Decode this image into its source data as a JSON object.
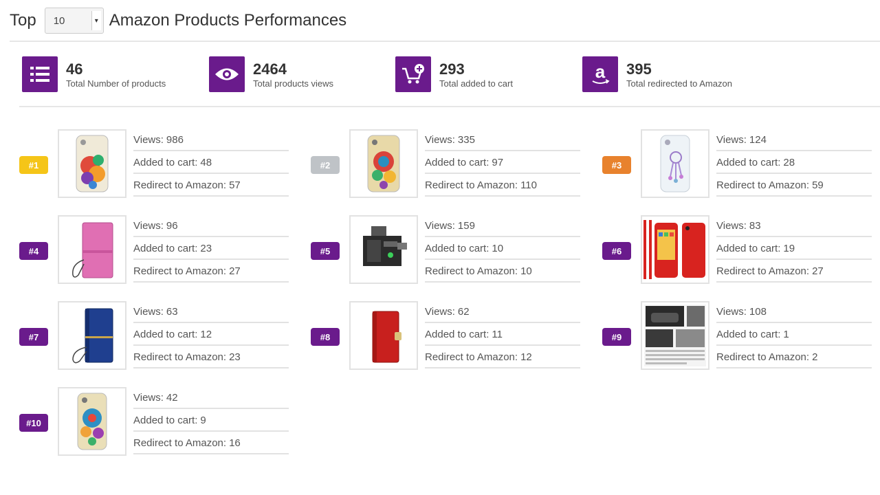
{
  "header": {
    "top_label": "Top",
    "select_value": "10",
    "title": "Amazon Products Performances"
  },
  "stats": [
    {
      "icon": "list-icon",
      "value": "46",
      "label": "Total Number of products"
    },
    {
      "icon": "eye-icon",
      "value": "2464",
      "label": "Total products views"
    },
    {
      "icon": "cart-add-icon",
      "value": "293",
      "label": "Total added to cart"
    },
    {
      "icon": "amazon-icon",
      "value": "395",
      "label": "Total redirected to Amazon"
    }
  ],
  "labels": {
    "views": "Views:",
    "cart": "Added to cart:",
    "redirect": "Redirect to Amazon:"
  },
  "colors": {
    "purple": "#6a1b8c",
    "gold": "#f5c518",
    "silver": "#bfc3c7",
    "bronze": "#e8822d"
  },
  "products": [
    {
      "rank": "#1",
      "views": "986",
      "cart": "48",
      "redirect": "57",
      "thumb": "floral-phone-case"
    },
    {
      "rank": "#2",
      "views": "335",
      "cart": "97",
      "redirect": "110",
      "thumb": "colorful-owl-phone-case"
    },
    {
      "rank": "#3",
      "views": "124",
      "cart": "28",
      "redirect": "59",
      "thumb": "clear-dreamcatcher-phone-case"
    },
    {
      "rank": "#4",
      "views": "96",
      "cart": "23",
      "redirect": "27",
      "thumb": "pink-wallet-case"
    },
    {
      "rank": "#5",
      "views": "159",
      "cart": "10",
      "redirect": "10",
      "thumb": "black-charger-device"
    },
    {
      "rank": "#6",
      "views": "83",
      "cart": "19",
      "redirect": "27",
      "thumb": "red-phone-skin"
    },
    {
      "rank": "#7",
      "views": "63",
      "cart": "12",
      "redirect": "23",
      "thumb": "blue-wallet-case"
    },
    {
      "rank": "#8",
      "views": "62",
      "cart": "11",
      "redirect": "12",
      "thumb": "red-wallet-case"
    },
    {
      "rank": "#9",
      "views": "108",
      "cart": "1",
      "redirect": "2",
      "thumb": "car-magazine-page"
    },
    {
      "rank": "#10",
      "views": "42",
      "cart": "9",
      "redirect": "16",
      "thumb": "owl-phone-case"
    }
  ]
}
